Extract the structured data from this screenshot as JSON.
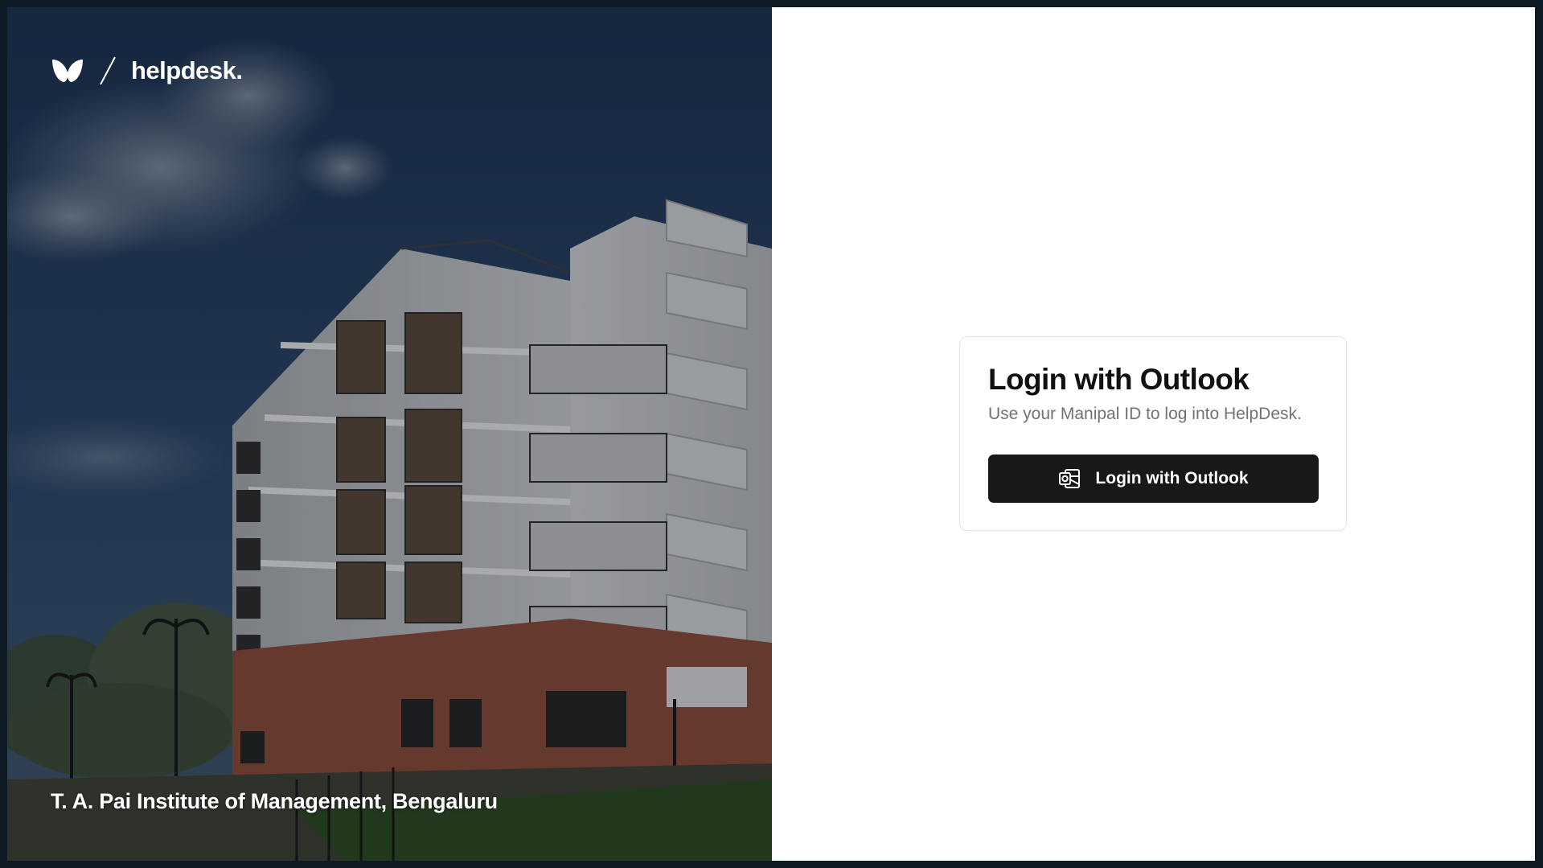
{
  "brand": {
    "name": "helpdesk."
  },
  "hero": {
    "caption": "T. A. Pai Institute of Management, Bengaluru"
  },
  "login_card": {
    "title": "Login with Outlook",
    "subtitle": "Use your Manipal ID to log into HelpDesk.",
    "button_label": "Login with Outlook",
    "button_icon": "outlook-icon"
  },
  "colors": {
    "button_bg": "#18181b",
    "panel_bg": "#ffffff",
    "subtitle_text": "#71717a",
    "frame_bg": "#0e1a24"
  }
}
